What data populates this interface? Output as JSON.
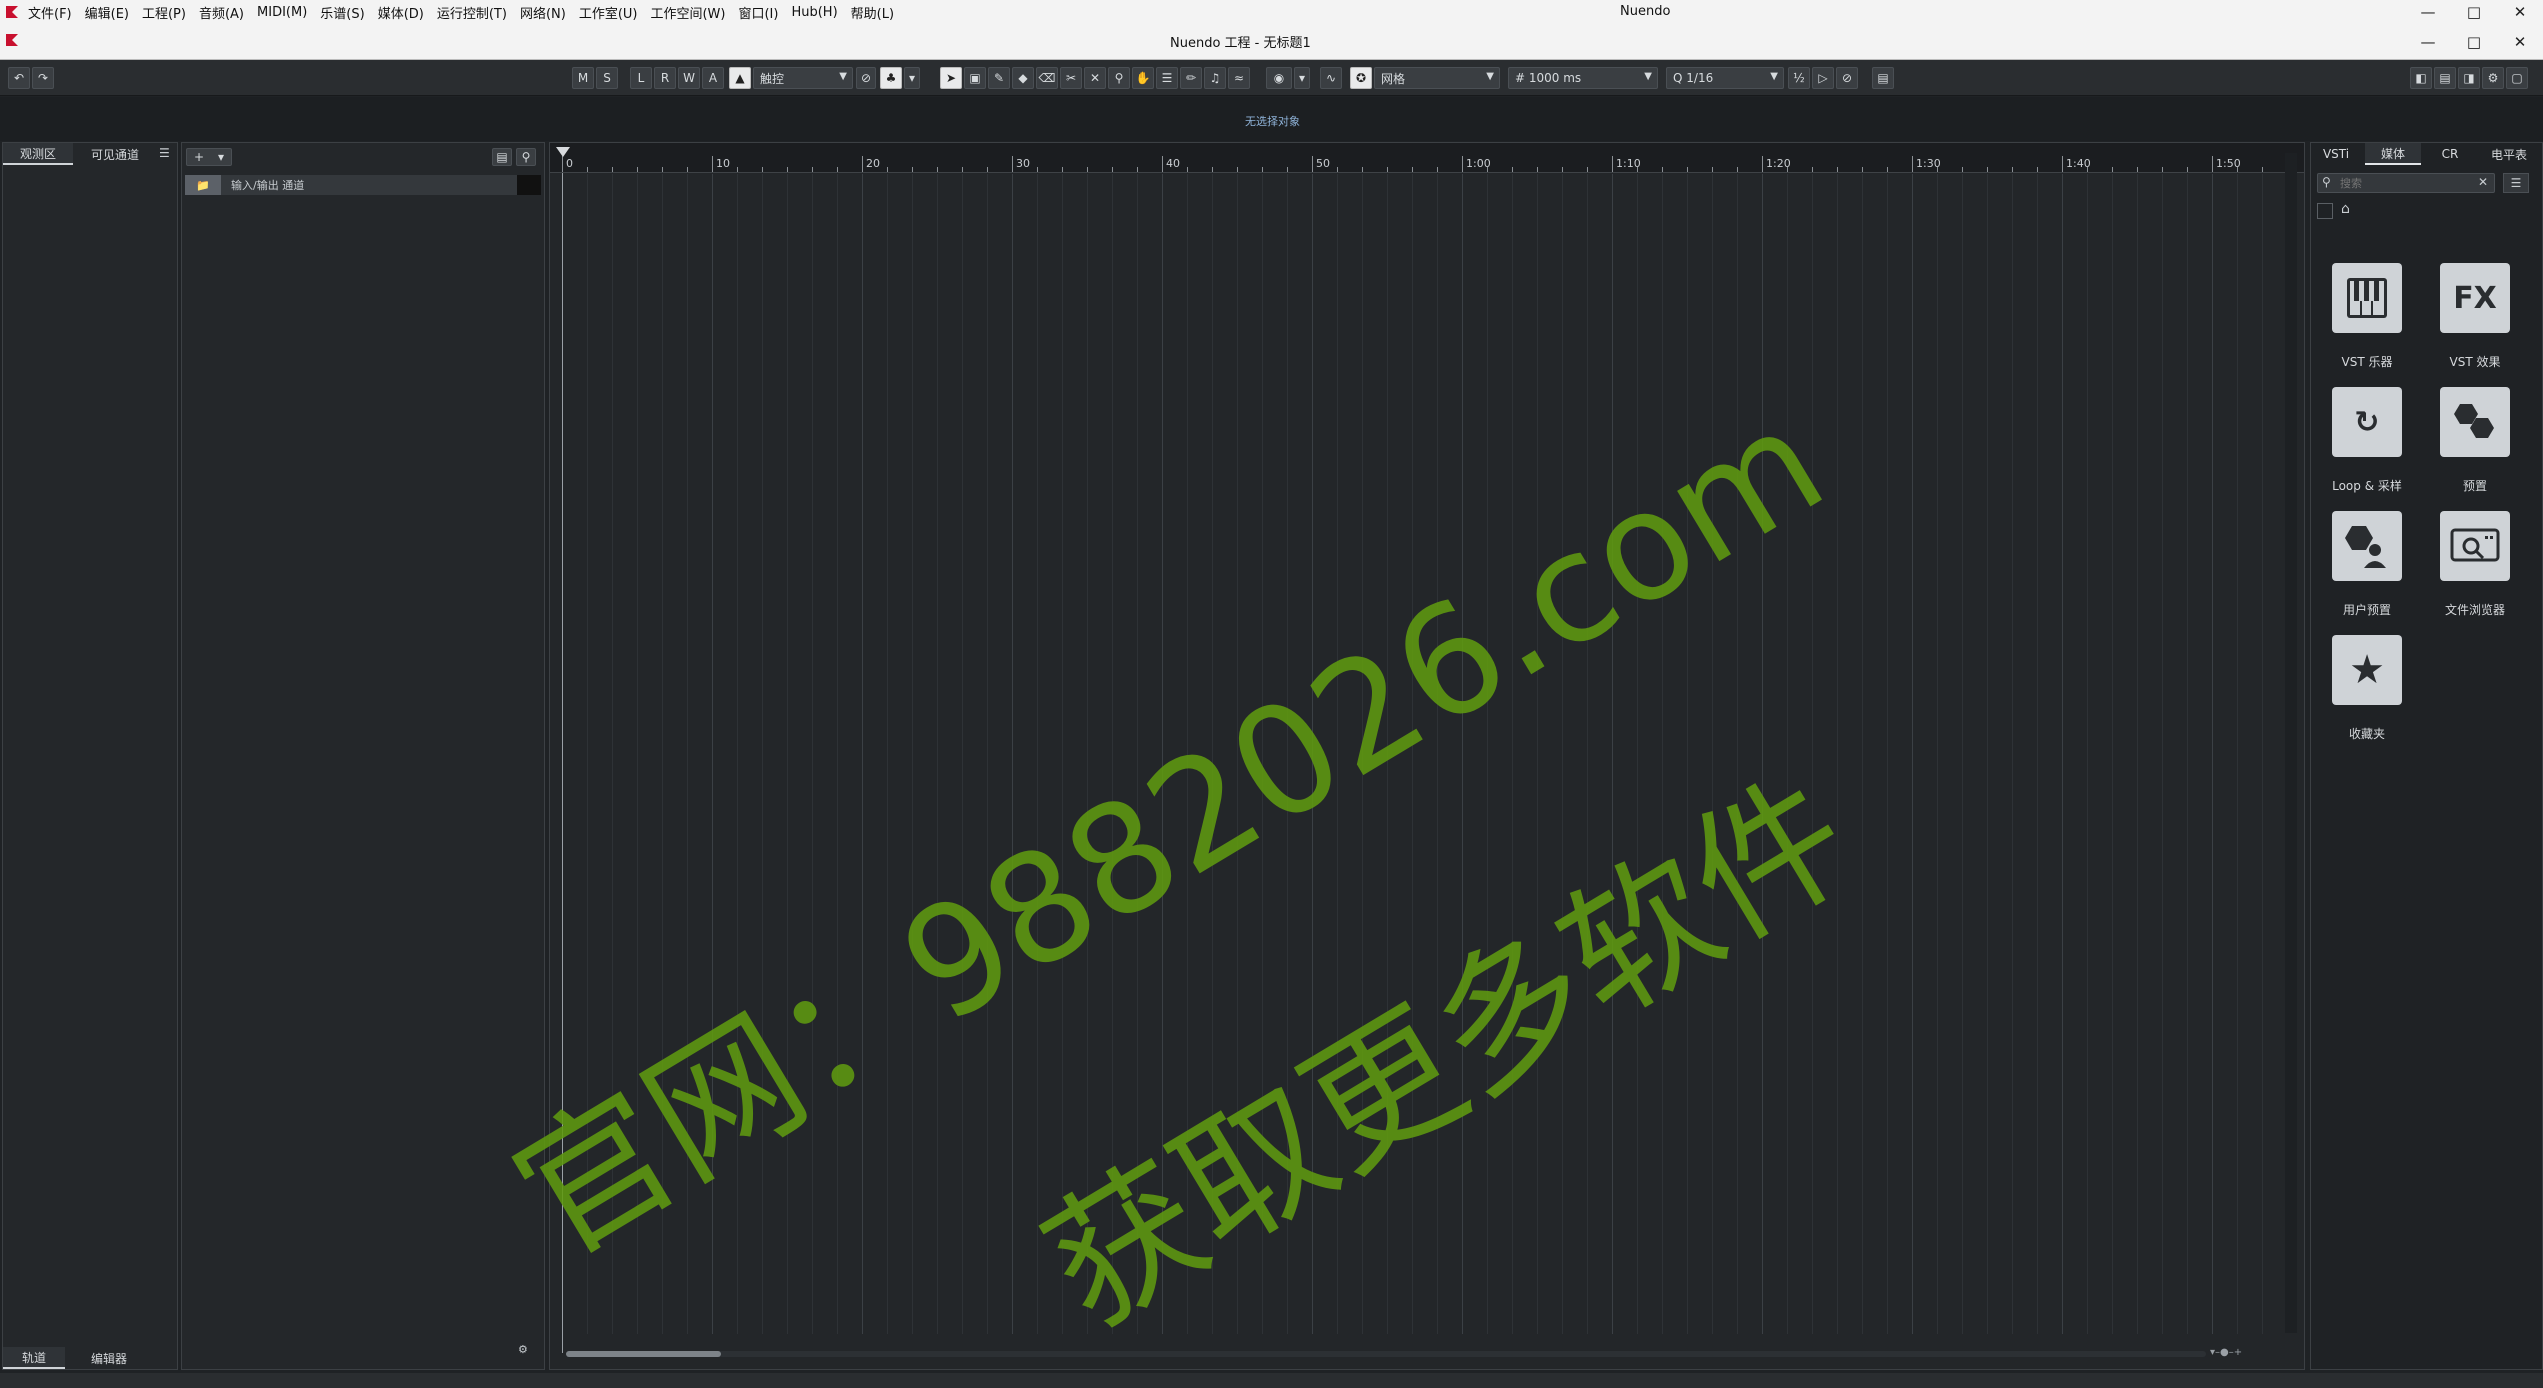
{
  "menubar": {
    "items": [
      "文件(F)",
      "编辑(E)",
      "工程(P)",
      "音频(A)",
      "MIDI(M)",
      "乐谱(S)",
      "媒体(D)",
      "运行控制(T)",
      "网络(N)",
      "工作室(U)",
      "工作空间(W)",
      "窗口(I)",
      "Hub(H)",
      "帮助(L)"
    ],
    "app_title": "Nuendo"
  },
  "project": {
    "title": "Nuendo 工程 - 无标题1"
  },
  "toolbar": {
    "msrwa": [
      "M",
      "S",
      "L",
      "R",
      "W",
      "A"
    ],
    "automation_mode": "触控",
    "snap_type": "网格",
    "grid_value": "1000 ms",
    "quantize": "1/16"
  },
  "info": {
    "no_selection": "无选择对象"
  },
  "left_panel": {
    "tabs": [
      "观测区",
      "可见通道"
    ],
    "bottom_tabs": [
      "轨道",
      "编辑器"
    ]
  },
  "track_list": {
    "tracks": [
      {
        "name": "输入/输出 通道"
      }
    ]
  },
  "ruler": {
    "labels": [
      "0",
      "10",
      "20",
      "30",
      "40",
      "50",
      "1:00",
      "1:10",
      "1:20",
      "1:30",
      "1:40",
      "1:50"
    ]
  },
  "right_panel": {
    "tabs": [
      "VSTi",
      "媒体",
      "CR",
      "电平表"
    ],
    "search_placeholder": "搜索",
    "tiles": [
      {
        "icon": "piano-keys-icon",
        "label": "VST 乐器"
      },
      {
        "icon": "fx-icon",
        "glyph": "FX",
        "label": "VST 效果"
      },
      {
        "icon": "loop-icon",
        "label": "Loop & 采样"
      },
      {
        "icon": "hexagons-icon",
        "label": "预置"
      },
      {
        "icon": "user-preset-icon",
        "label": "用户预置"
      },
      {
        "icon": "file-browser-icon",
        "label": "文件浏览器"
      },
      {
        "icon": "star-icon",
        "label": "收藏夹"
      }
    ]
  },
  "watermark": {
    "line1": "官网：9882026.com",
    "line2": "获取更多软件"
  },
  "colors": {
    "watermark": "#5f9a10",
    "accent_logo": "#c8102e",
    "background": "#1f2225"
  }
}
